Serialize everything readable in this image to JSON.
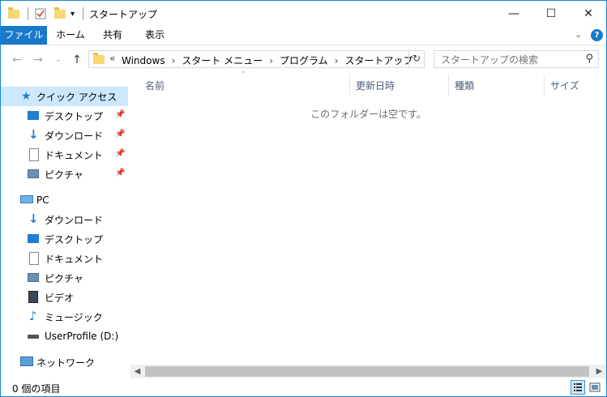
{
  "window": {
    "title": "スタートアップ",
    "controls": {
      "minimize": "—",
      "maximize": "☐",
      "close": "✕"
    }
  },
  "ribbon": {
    "tabs": [
      "ファイル",
      "ホーム",
      "共有",
      "表示"
    ],
    "help": "?"
  },
  "address": {
    "overflow": "«",
    "crumbs": [
      "Windows",
      "スタート メニュー",
      "プログラム",
      "スタートアップ"
    ]
  },
  "search": {
    "placeholder": "スタートアップの検索"
  },
  "nav": {
    "quick_access": {
      "label": "クイック アクセス",
      "items": [
        "デスクトップ",
        "ダウンロード",
        "ドキュメント",
        "ピクチャ"
      ]
    },
    "pc": {
      "label": "PC",
      "items": [
        "ダウンロード",
        "デスクトップ",
        "ドキュメント",
        "ピクチャ",
        "ビデオ",
        "ミュージック",
        "UserProfile (D:)"
      ]
    },
    "network": {
      "label": "ネットワーク"
    }
  },
  "content": {
    "columns": [
      "名前",
      "更新日時",
      "種類",
      "サイズ"
    ],
    "empty_message": "このフォルダーは空です。"
  },
  "status": {
    "item_count": "0 個の項目"
  },
  "colors": {
    "accent": "#1979ca",
    "selected": "#cce8ff",
    "folder": "#f8d775"
  }
}
